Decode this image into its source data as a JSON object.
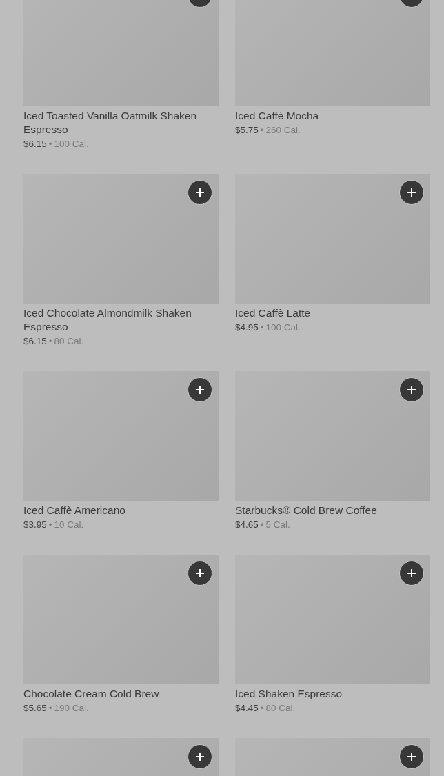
{
  "items": [
    {
      "kind": "full",
      "name": "Iced Toasted Vanilla Oatmilk Shaken Espresso",
      "price": "$6.15",
      "separator": "•",
      "calories": "100 Cal."
    },
    {
      "kind": "full",
      "name": "Iced Caffè Mocha",
      "price": "$5.75",
      "separator": "•",
      "calories": "260 Cal."
    },
    {
      "kind": "full",
      "name": "Iced Chocolate Almondmilk Shaken Espresso",
      "price": "$6.15",
      "separator": "•",
      "calories": "80 Cal."
    },
    {
      "kind": "full",
      "name": "Iced Caffè Latte",
      "price": "$4.95",
      "separator": "•",
      "calories": "100 Cal."
    },
    {
      "kind": "full",
      "name": "Iced Caffè Americano",
      "price": "$3.95",
      "separator": "•",
      "calories": "10 Cal."
    },
    {
      "kind": "full",
      "name": "Starbucks® Cold Brew Coffee",
      "price": "$4.65",
      "separator": "•",
      "calories": "5 Cal."
    },
    {
      "kind": "full",
      "name": "Chocolate Cream Cold Brew",
      "price": "$5.65",
      "separator": "•",
      "calories": "190 Cal."
    },
    {
      "kind": "full",
      "name": "Iced Shaken Espresso",
      "price": "$4.45",
      "separator": "•",
      "calories": "80 Cal."
    },
    {
      "kind": "image_only"
    },
    {
      "kind": "image_only"
    }
  ]
}
